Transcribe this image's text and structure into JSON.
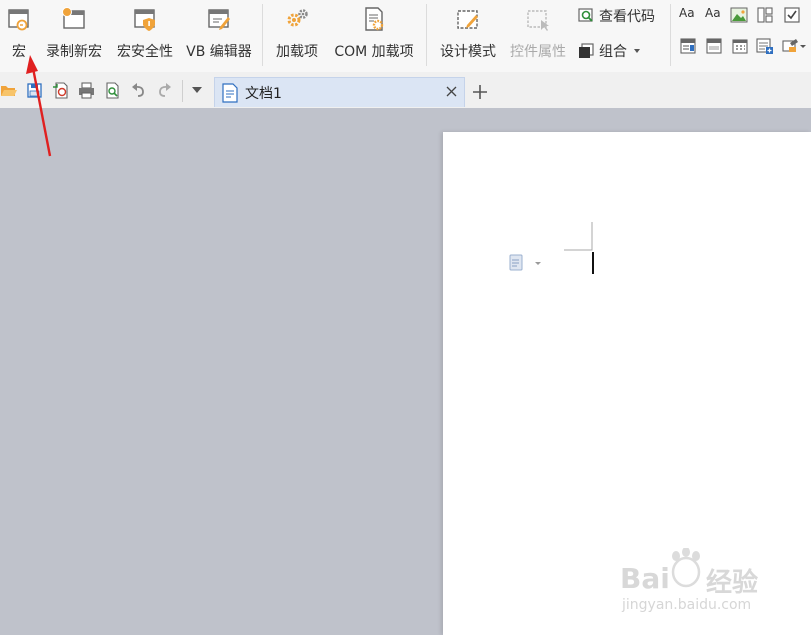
{
  "ribbon": {
    "buttons": [
      {
        "id": "macro",
        "label": "宏"
      },
      {
        "id": "record",
        "label": "录制新宏"
      },
      {
        "id": "security",
        "label": "宏安全性"
      },
      {
        "id": "vb",
        "label": "VB 编辑器"
      },
      {
        "id": "addins",
        "label": "加载项"
      },
      {
        "id": "com",
        "label": "COM 加载项"
      },
      {
        "id": "design",
        "label": "设计模式"
      },
      {
        "id": "props",
        "label": "控件属性"
      }
    ],
    "view_code_label": "查看代码",
    "group_label": "组合",
    "text_aa_1": "Aa",
    "text_aa_2": "Aa"
  },
  "tabs": [
    {
      "label": "文档1"
    }
  ],
  "watermark": {
    "brand_left": "Bai",
    "brand_right": "经验",
    "url": "jingyan.baidu.com"
  },
  "colors": {
    "accent_orange": "#f0a33a",
    "workspace": "#bfc2cb",
    "annotation_arrow": "#e02020",
    "tab_active": "#dbe5f4"
  }
}
